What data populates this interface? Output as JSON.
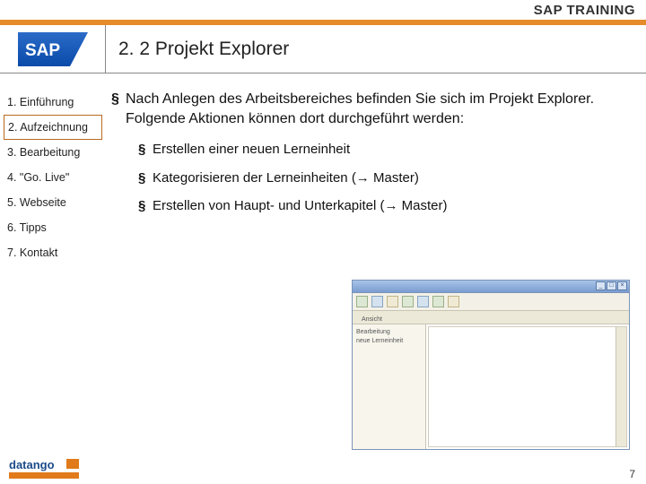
{
  "header": {
    "title": "SAP TRAINING"
  },
  "logo": {
    "sap_text": "SAP"
  },
  "page": {
    "title": "2. 2 Projekt Explorer",
    "number": "7"
  },
  "sidebar": {
    "items": [
      {
        "label": "1. Einführung",
        "active": false
      },
      {
        "label": "2. Aufzeichnung",
        "active": true
      },
      {
        "label": "3. Bearbeitung",
        "active": false
      },
      {
        "label": "4. \"Go. Live\"",
        "active": false
      },
      {
        "label": "5. Webseite",
        "active": false
      },
      {
        "label": "6. Tipps",
        "active": false
      },
      {
        "label": "7. Kontakt",
        "active": false
      }
    ]
  },
  "content": {
    "intro": "Nach Anlegen des Arbeitsbereiches befinden Sie sich im Projekt Explorer. Folgende Aktionen können dort durchgeführt werden:",
    "bullets": [
      "Erstellen einer neuen Lerneinheit",
      "Kategorisieren der Lerneinheiten (→ Master)",
      "Erstellen von Haupt- und Unterkapitel (→ Master)"
    ]
  },
  "embedded_window": {
    "tabs": [
      "Ansicht"
    ],
    "side_lines": [
      "Bearbeitung",
      "",
      "neue Lerneinheit"
    ]
  },
  "footer_logo": {
    "text": "datango"
  }
}
